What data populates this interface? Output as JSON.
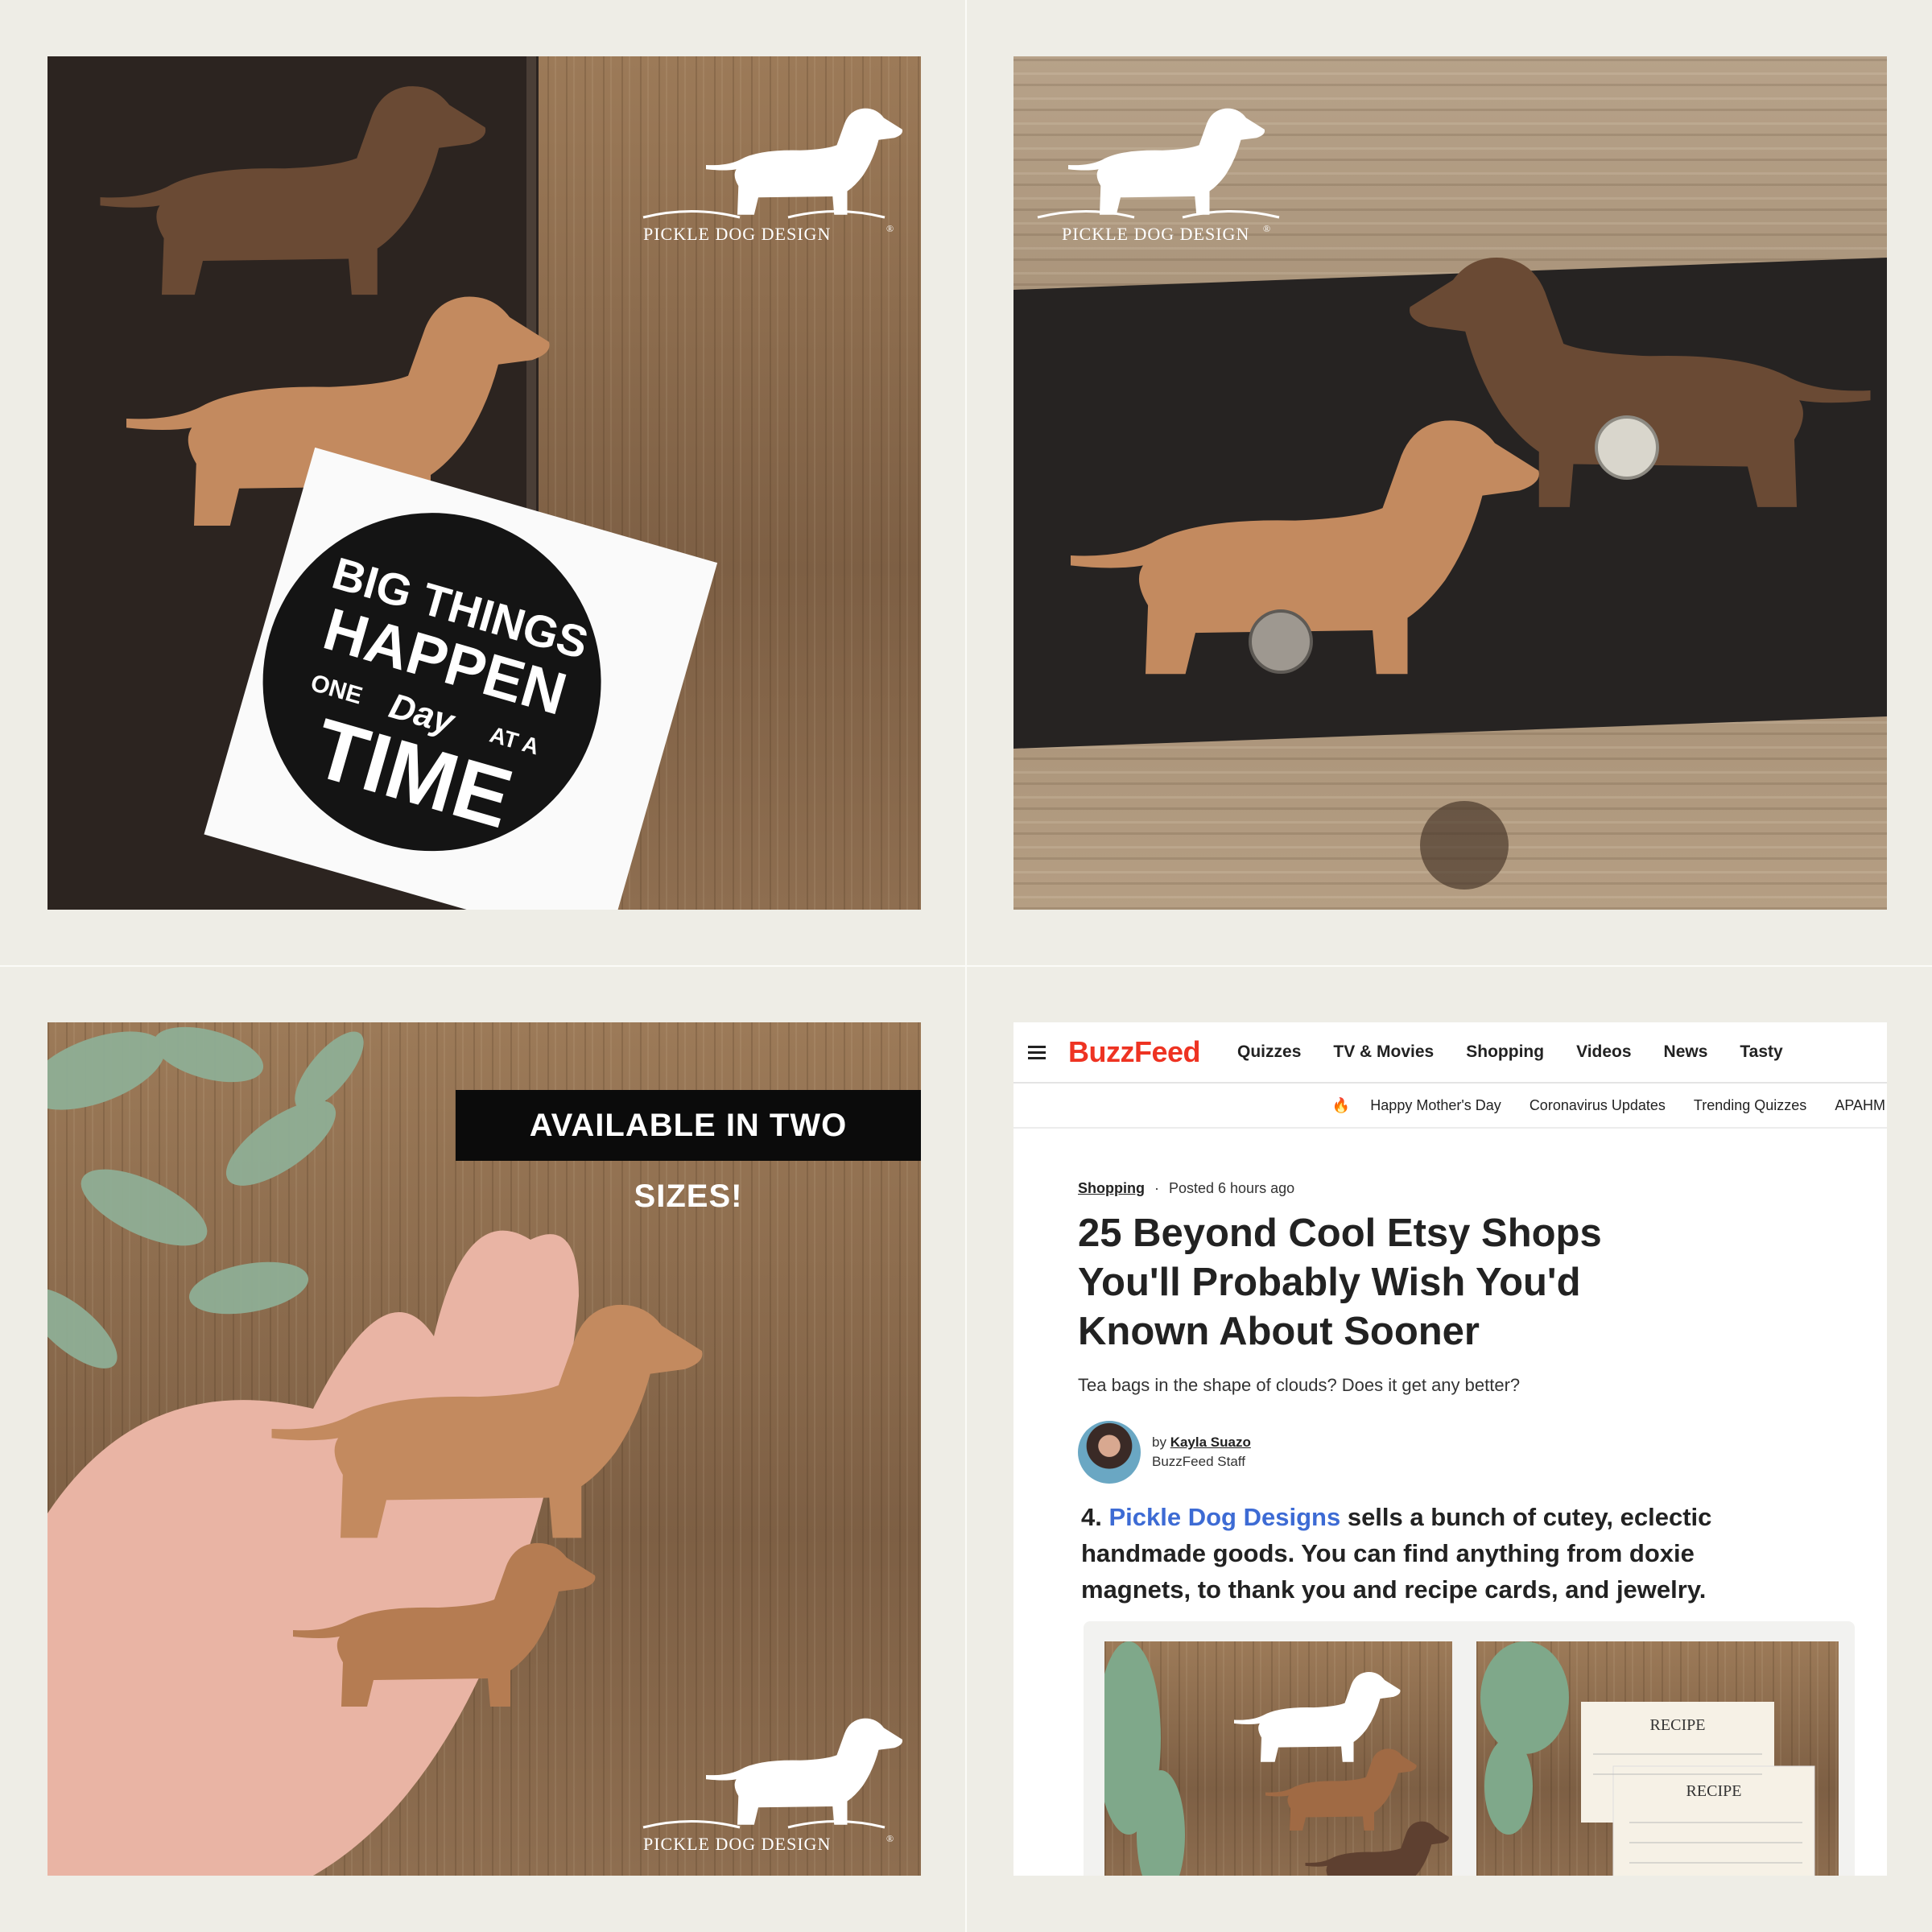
{
  "panels": {
    "top_left": {
      "watermark": "PICKLE DOG DESIGN",
      "watermark_mark": "®",
      "card_lines": [
        "BIG THINGS",
        "HAPPEN",
        "ONE",
        "Day",
        "AT A",
        "TIME"
      ]
    },
    "top_right": {
      "watermark": "PICKLE DOG DESIGN",
      "watermark_mark": "®"
    },
    "bottom_left": {
      "banner": "AVAILABLE IN TWO SIZES!",
      "watermark": "PICKLE DOG DESIGN",
      "watermark_mark": "®"
    },
    "bottom_right": {
      "buzzfeed": {
        "logo": "BuzzFeed",
        "nav": [
          "Quizzes",
          "TV & Movies",
          "Shopping",
          "Videos",
          "News",
          "Tasty"
        ],
        "subnav": [
          "Happy Mother's Day",
          "Coronavirus Updates",
          "Trending Quizzes",
          "APAHM"
        ],
        "category": "Shopping",
        "posted": "Posted 6 hours ago",
        "title": "25 Beyond Cool Etsy Shops You'll Probably Wish You'd Known About Sooner",
        "dek": "Tea bags in the shape of clouds? Does it get any better?",
        "author_prefix": "by",
        "author": "Kayla Suazo",
        "author_role": "BuzzFeed Staff",
        "item_number": "4.",
        "item_link": "Pickle Dog Designs",
        "item_text": "sells a bunch of cutey, eclectic handmade goods. You can find anything from doxie magnets, to thank you and recipe cards, and jewelry.",
        "recipe_label_1": "RECIPE",
        "recipe_label_2": "RECIPE",
        "icons": {
          "menu": "hamburger-icon",
          "trending": "fire-icon"
        }
      }
    }
  },
  "colors": {
    "buzzfeed_red": "#ee3322",
    "link_blue": "#3d6bd4",
    "walnut": "#6a4a34",
    "cherry": "#c38a5f",
    "banner_black": "#0b0b0b"
  }
}
